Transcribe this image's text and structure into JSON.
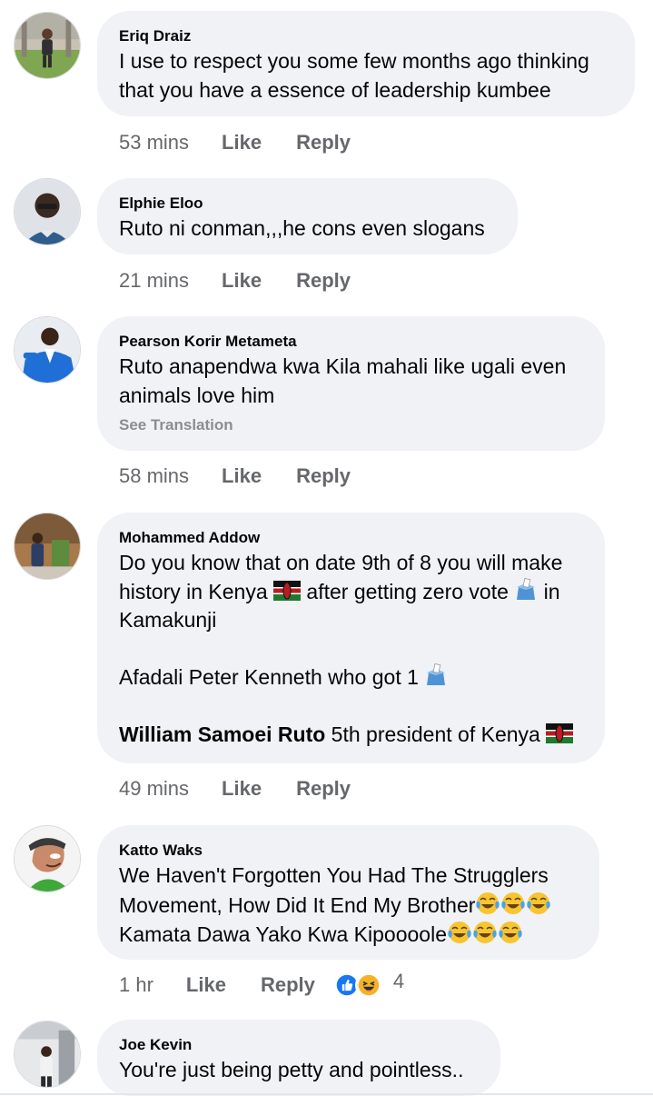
{
  "comments": [
    {
      "author": "Eriq Draiz",
      "text": "I use to respect you some few months ago thinking that you have a essence of leadership kumbee",
      "time": "53 mins",
      "like_label": "Like",
      "reply_label": "Reply"
    },
    {
      "author": "Elphie Eloo",
      "text": "Ruto ni conman,,,he cons even slogans",
      "time": "21 mins",
      "like_label": "Like",
      "reply_label": "Reply"
    },
    {
      "author": "Pearson Korir Metameta",
      "text": "Ruto anapendwa kwa Kila mahali like ugali even animals love him",
      "see_translation": "See Translation",
      "time": "58 mins",
      "like_label": "Like",
      "reply_label": "Reply"
    },
    {
      "author": "Mohammed Addow",
      "lines": [
        "Do you know that on date 9th of 8 you will make",
        "history in Kenya",
        "after getting zero vote",
        "in",
        "Kamakunji",
        "Afadali Peter Kenneth who got 1",
        "William Samoei Ruto",
        "5th president of Kenya"
      ],
      "time": "49 mins",
      "like_label": "Like",
      "reply_label": "Reply"
    },
    {
      "author": "Katto Waks",
      "lines": [
        "We Haven't Forgotten You Had The Strugglers",
        "Movement, How Did It End My Brother",
        "Kamata Dawa Yako Kwa Kipoooole"
      ],
      "time": "1 hr",
      "like_label": "Like",
      "reply_label": "Reply",
      "reaction_icons": [
        "like-reaction-icon",
        "haha-reaction-icon"
      ],
      "reaction_count": "4"
    },
    {
      "author": "Joe Kevin",
      "text": "You're just being petty and pointless.."
    }
  ],
  "colors": {
    "bubble_bg": "#f0f2f5",
    "meta_text": "#65676b",
    "like_blue": "#1877f2",
    "haha_yellow": "#f7b125"
  }
}
